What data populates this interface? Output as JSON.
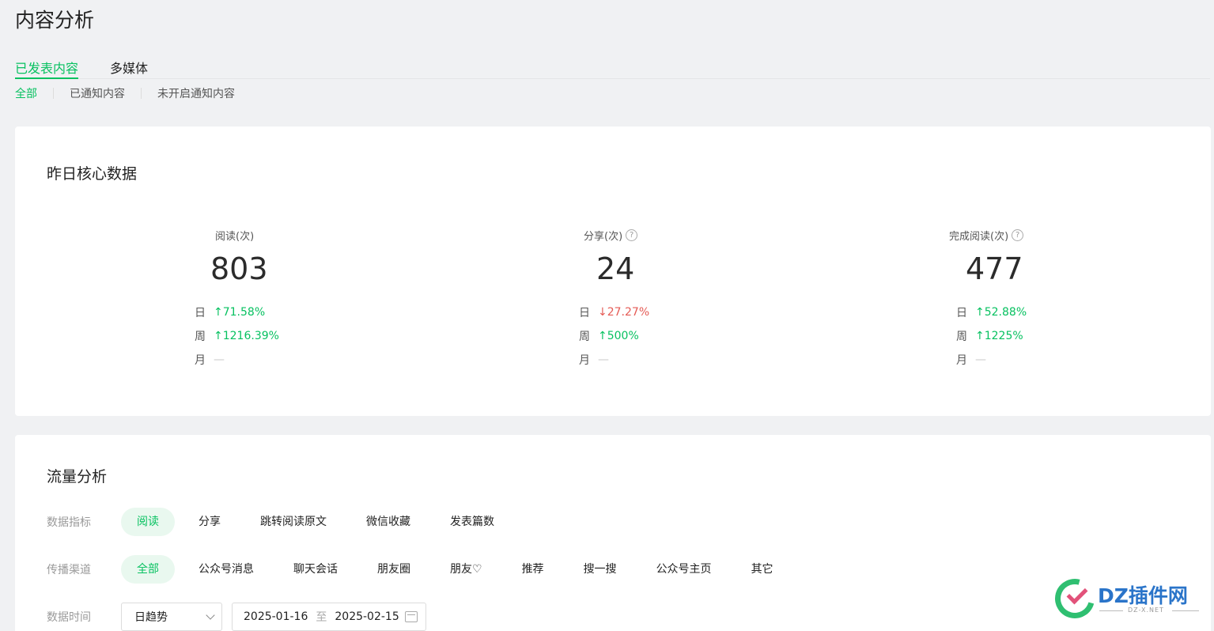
{
  "page": {
    "title": "内容分析"
  },
  "tabs": [
    {
      "label": "已发表内容",
      "active": true
    },
    {
      "label": "多媒体",
      "active": false
    }
  ],
  "subtabs": [
    {
      "label": "全部",
      "active": true
    },
    {
      "label": "已通知内容",
      "active": false
    },
    {
      "label": "未开启通知内容",
      "active": false
    }
  ],
  "core": {
    "title": "昨日核心数据",
    "metrics": [
      {
        "label": "阅读(次)",
        "value": "803",
        "help": false,
        "day": {
          "label": "日",
          "dir": "up",
          "value": "71.58%"
        },
        "week": {
          "label": "周",
          "dir": "up",
          "value": "1216.39%"
        },
        "month": {
          "label": "月",
          "value": "—"
        }
      },
      {
        "label": "分享(次)",
        "value": "24",
        "help": true,
        "day": {
          "label": "日",
          "dir": "down",
          "value": "27.27%"
        },
        "week": {
          "label": "周",
          "dir": "up",
          "value": "500%"
        },
        "month": {
          "label": "月",
          "value": "—"
        }
      },
      {
        "label": "完成阅读(次)",
        "value": "477",
        "help": true,
        "day": {
          "label": "日",
          "dir": "up",
          "value": "52.88%"
        },
        "week": {
          "label": "周",
          "dir": "up",
          "value": "1225%"
        },
        "month": {
          "label": "月",
          "value": "—"
        }
      }
    ]
  },
  "traffic": {
    "title": "流量分析",
    "indicator_label": "数据指标",
    "indicators": [
      "阅读",
      "分享",
      "跳转阅读原文",
      "微信收藏",
      "发表篇数"
    ],
    "channel_label": "传播渠道",
    "channels": [
      "全部",
      "公众号消息",
      "聊天会话",
      "朋友圈",
      "朋友♡",
      "推荐",
      "搜一搜",
      "公众号主页",
      "其它"
    ],
    "time_label": "数据时间",
    "trend_select": "日趋势",
    "date_start": "2025-01-16",
    "date_to": "至",
    "date_end": "2025-02-15"
  },
  "watermark": {
    "text": "DZ插件网",
    "sub": "DZ-X.NET"
  },
  "colors": {
    "accent": "#07c160",
    "down": "#e55b55",
    "background": "#f0f1f3"
  }
}
